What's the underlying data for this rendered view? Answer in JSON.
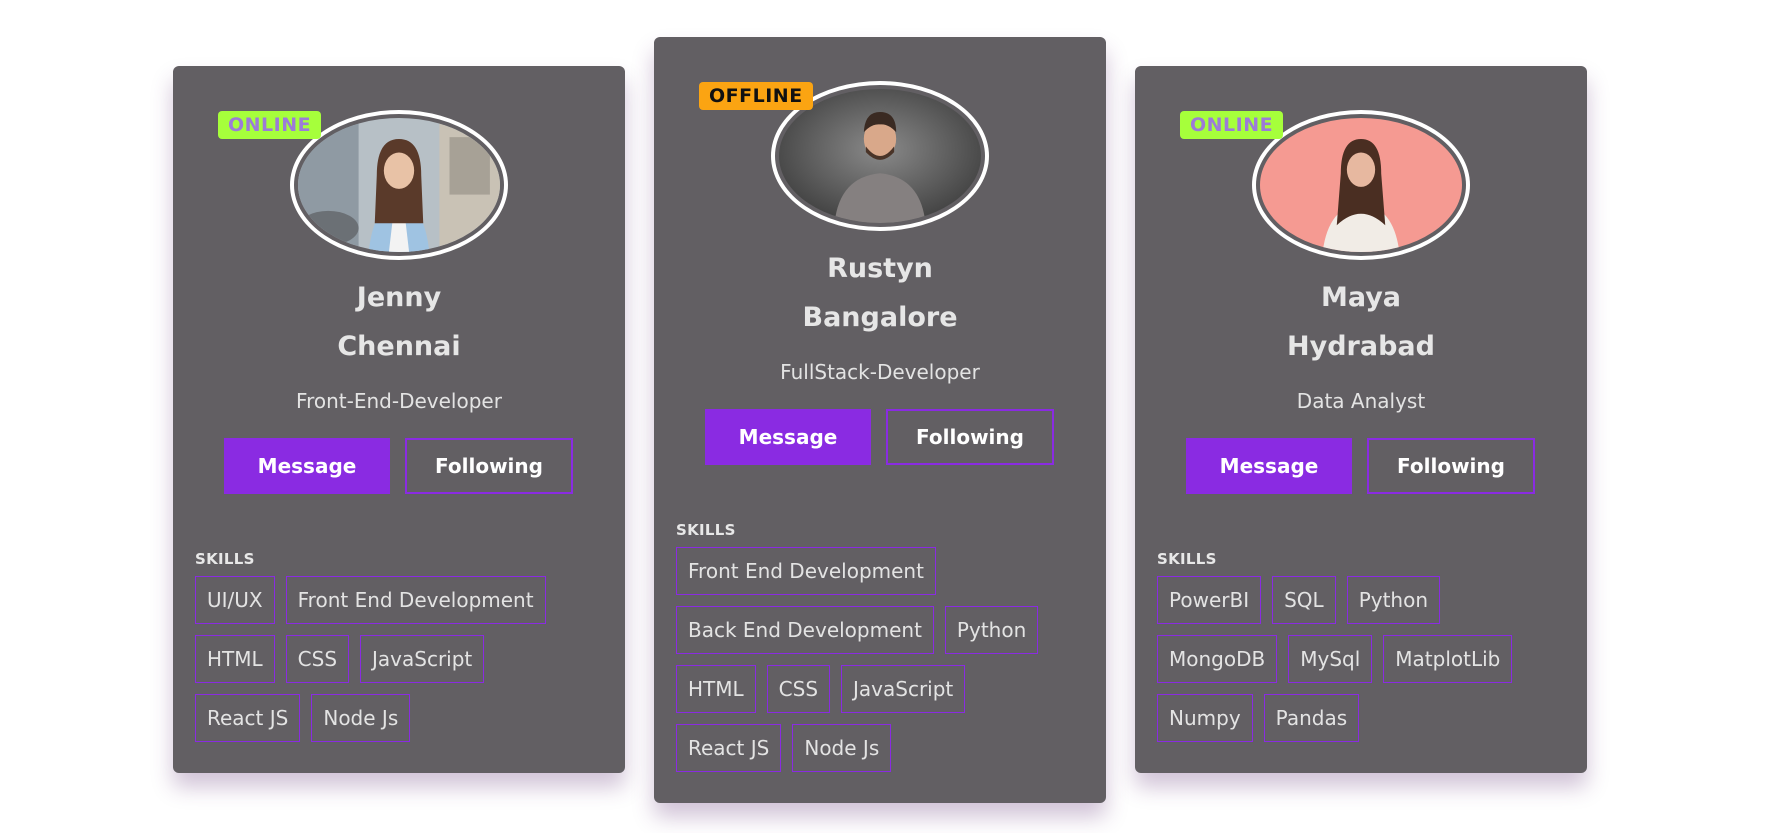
{
  "cards": [
    {
      "status": "ONLINE",
      "name": "Jenny",
      "city": "Chennai",
      "role": "Front-End-Developer",
      "message_label": "Message",
      "follow_label": "Following",
      "skills_label": "SKILLS",
      "skills": [
        "UI/UX",
        "Front End Development",
        "HTML",
        "CSS",
        "JavaScript",
        "React JS",
        "Node Js"
      ]
    },
    {
      "status": "OFFLINE",
      "name": "Rustyn",
      "city": "Bangalore",
      "role": "FullStack-Developer",
      "message_label": "Message",
      "follow_label": "Following",
      "skills_label": "SKILLS",
      "skills": [
        "Front End Development",
        "Back End Development",
        "Python",
        "HTML",
        "CSS",
        "JavaScript",
        "React JS",
        "Node Js"
      ]
    },
    {
      "status": "ONLINE",
      "name": "Maya",
      "city": "Hydrabad",
      "role": "Data Analyst",
      "message_label": "Message",
      "follow_label": "Following",
      "skills_label": "SKILLS",
      "skills": [
        "PowerBI",
        "SQL",
        "Python",
        "MongoDB",
        "MySql",
        "MatplotLib",
        "Numpy",
        "Pandas"
      ]
    }
  ],
  "colors": {
    "card_bg": "#625f63",
    "accent": "#8a2be2",
    "online": "#a6ff3b",
    "offline": "#fba412"
  }
}
